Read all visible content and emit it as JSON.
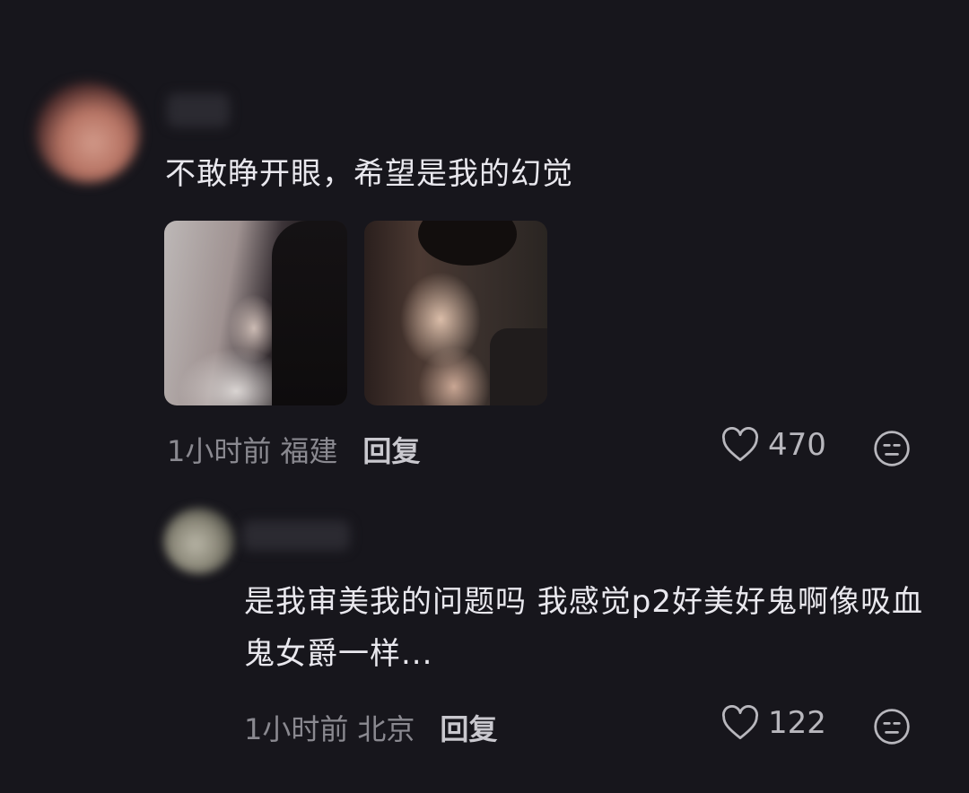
{
  "comments": [
    {
      "text": "不敢睁开眼，希望是我的幻觉",
      "time": "1小时前",
      "location": "福建",
      "reply_label": "回复",
      "likes": "470",
      "images": 2
    },
    {
      "text": "是我审美我的问题吗 我感觉p2好美好鬼啊像吸血鬼女爵一样...",
      "time": "1小时前",
      "location": "北京",
      "reply_label": "回复",
      "likes": "122"
    }
  ],
  "colors": {
    "background": "#17161c",
    "text_primary": "#e9e8ee",
    "text_meta": "#8a8990"
  },
  "icons": [
    "heart-icon",
    "emoji-icon"
  ]
}
